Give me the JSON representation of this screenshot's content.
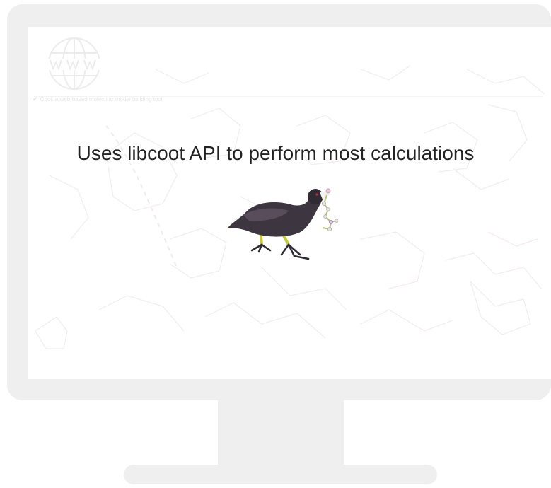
{
  "caption": "Uses libcoot API to perform most calculations",
  "screen": {
    "breadcrumb": "Coot: a web-based molecular model building tool"
  },
  "icons": {
    "globe": "globe-www-icon",
    "check": "check-icon",
    "mascot": "coot-bird-illustration"
  },
  "colors": {
    "monitor_frame": "#efefef",
    "bird_body": "#3d3540",
    "bird_legs": "#c7c83a",
    "caption_text": "#222222"
  }
}
